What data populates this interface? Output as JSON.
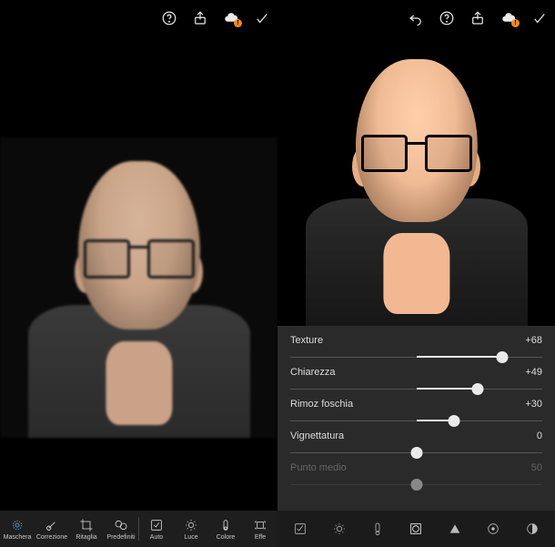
{
  "left": {
    "topbar": {
      "help_icon": "help-icon",
      "share_icon": "share-icon",
      "cloud_icon": "cloud-sync-icon",
      "done_icon": "checkmark-icon"
    },
    "image": {
      "description": "Bald man with glasses, hand on chin, dark sweater, black background (slightly soft/blurred)"
    },
    "tools": [
      {
        "name": "maschera",
        "label": "Maschera",
        "icon": "mask-icon"
      },
      {
        "name": "correzione",
        "label": "Correzione",
        "icon": "heal-icon"
      },
      {
        "name": "ritaglia",
        "label": "Ritaglia",
        "icon": "crop-icon"
      },
      {
        "name": "predefiniti",
        "label": "Predefiniti",
        "icon": "presets-icon"
      },
      {
        "name": "auto",
        "label": "Auto",
        "icon": "auto-icon"
      },
      {
        "name": "luce",
        "label": "Luce",
        "icon": "light-icon"
      },
      {
        "name": "colore",
        "label": "Colore",
        "icon": "color-icon"
      },
      {
        "name": "effetti",
        "label": "Effe",
        "icon": "effects-icon"
      }
    ]
  },
  "right": {
    "topbar": {
      "undo_icon": "undo-icon",
      "help_icon": "help-icon",
      "share_icon": "share-icon",
      "cloud_icon": "cloud-sync-icon",
      "done_icon": "checkmark-icon"
    },
    "image": {
      "description": "Same portrait, sharper/higher clarity after effect adjustments"
    },
    "sliders": [
      {
        "name": "texture",
        "label": "Texture",
        "value": "+68",
        "min": -100,
        "max": 100,
        "num": 68
      },
      {
        "name": "chiarezza",
        "label": "Chiarezza",
        "value": "+49",
        "min": -100,
        "max": 100,
        "num": 49
      },
      {
        "name": "rimoz-foschia",
        "label": "Rimoz foschia",
        "value": "+30",
        "min": -100,
        "max": 100,
        "num": 30
      },
      {
        "name": "vignettatura",
        "label": "Vignettatura",
        "value": "0",
        "min": -100,
        "max": 100,
        "num": 0
      },
      {
        "name": "punto-medio",
        "label": "Punto medio",
        "value": "50",
        "min": 0,
        "max": 100,
        "num": 50,
        "disabled": true
      }
    ],
    "bottom_icons": [
      {
        "name": "auto",
        "icon": "auto-wand-icon"
      },
      {
        "name": "light",
        "icon": "sun-icon"
      },
      {
        "name": "color",
        "icon": "thermometer-icon"
      },
      {
        "name": "effects",
        "icon": "aperture-icon",
        "selected": true
      },
      {
        "name": "detail",
        "icon": "triangle-icon"
      },
      {
        "name": "crop",
        "icon": "target-icon"
      },
      {
        "name": "optics",
        "icon": "half-circle-icon"
      }
    ]
  }
}
